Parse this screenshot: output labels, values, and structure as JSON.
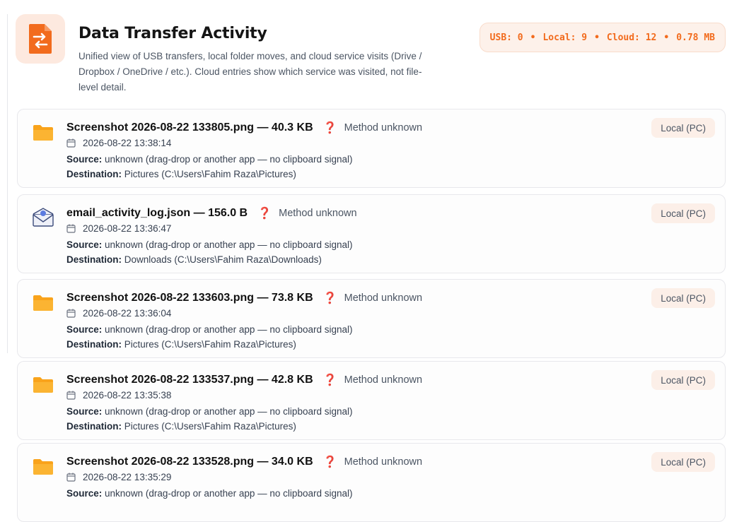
{
  "header": {
    "title": "Data Transfer Activity",
    "description": "Unified view of USB transfers, local folder moves, and cloud service visits (Drive / Dropbox / OneDrive / etc.). Cloud entries show which service was visited, not file-level detail.",
    "icon": "transfer-arrows-icon",
    "stats": {
      "usb": "USB: 0",
      "local": "Local: 9",
      "cloud": "Cloud: 12",
      "size": "0.78 MB",
      "separator": "•"
    }
  },
  "colors": {
    "accent": "#f26b1d",
    "accent_soft": "#fde9df",
    "folder": "#f9a31b",
    "warning": "#e0242d"
  },
  "labels": {
    "source": "Source:",
    "destination": "Destination:"
  },
  "entries": [
    {
      "icon": "folder-icon",
      "title": "Screenshot 2026-08-22 133805.png — 40.3 KB",
      "status_icon": "❓",
      "method": "Method unknown",
      "timestamp": "2026-08-22 13:38:14",
      "source": "unknown (drag-drop or another app — no clipboard signal)",
      "destination": "Pictures (C:\\Users\\Fahim Raza\\Pictures)",
      "tag": "Local (PC)"
    },
    {
      "icon": "email-envelope-icon",
      "title": "email_activity_log.json — 156.0 B",
      "status_icon": "❓",
      "method": "Method unknown",
      "timestamp": "2026-08-22 13:36:47",
      "source": "unknown (drag-drop or another app — no clipboard signal)",
      "destination": "Downloads (C:\\Users\\Fahim Raza\\Downloads)",
      "tag": "Local (PC)"
    },
    {
      "icon": "folder-icon",
      "title": "Screenshot 2026-08-22 133603.png — 73.8 KB",
      "status_icon": "❓",
      "method": "Method unknown",
      "timestamp": "2026-08-22 13:36:04",
      "source": "unknown (drag-drop or another app — no clipboard signal)",
      "destination": "Pictures (C:\\Users\\Fahim Raza\\Pictures)",
      "tag": "Local (PC)"
    },
    {
      "icon": "folder-icon",
      "title": "Screenshot 2026-08-22 133537.png — 42.8 KB",
      "status_icon": "❓",
      "method": "Method unknown",
      "timestamp": "2026-08-22 13:35:38",
      "source": "unknown (drag-drop or another app — no clipboard signal)",
      "destination": "Pictures (C:\\Users\\Fahim Raza\\Pictures)",
      "tag": "Local (PC)"
    },
    {
      "icon": "folder-icon",
      "title": "Screenshot 2026-08-22 133528.png — 34.0 KB",
      "status_icon": "❓",
      "method": "Method unknown",
      "timestamp": "2026-08-22 13:35:29",
      "source": "unknown (drag-drop or another app — no clipboard signal)",
      "destination": "",
      "tag": "Local (PC)"
    }
  ]
}
